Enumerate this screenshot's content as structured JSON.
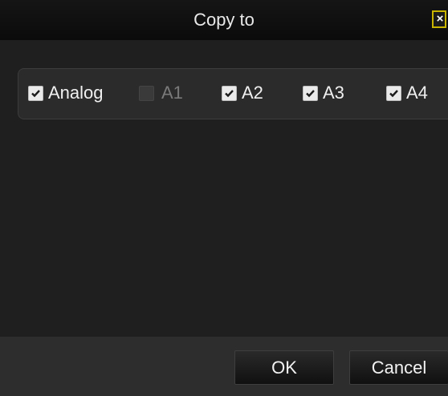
{
  "dialog": {
    "title": "Copy to",
    "close_icon": "close-icon",
    "close_glyph": "×"
  },
  "channels": [
    {
      "label": "Analog",
      "checked": true,
      "enabled": true
    },
    {
      "label": "A1",
      "checked": false,
      "enabled": false
    },
    {
      "label": "A2",
      "checked": true,
      "enabled": true
    },
    {
      "label": "A3",
      "checked": true,
      "enabled": true
    },
    {
      "label": "A4",
      "checked": true,
      "enabled": true
    }
  ],
  "footer": {
    "ok_label": "OK",
    "cancel_label": "Cancel"
  }
}
